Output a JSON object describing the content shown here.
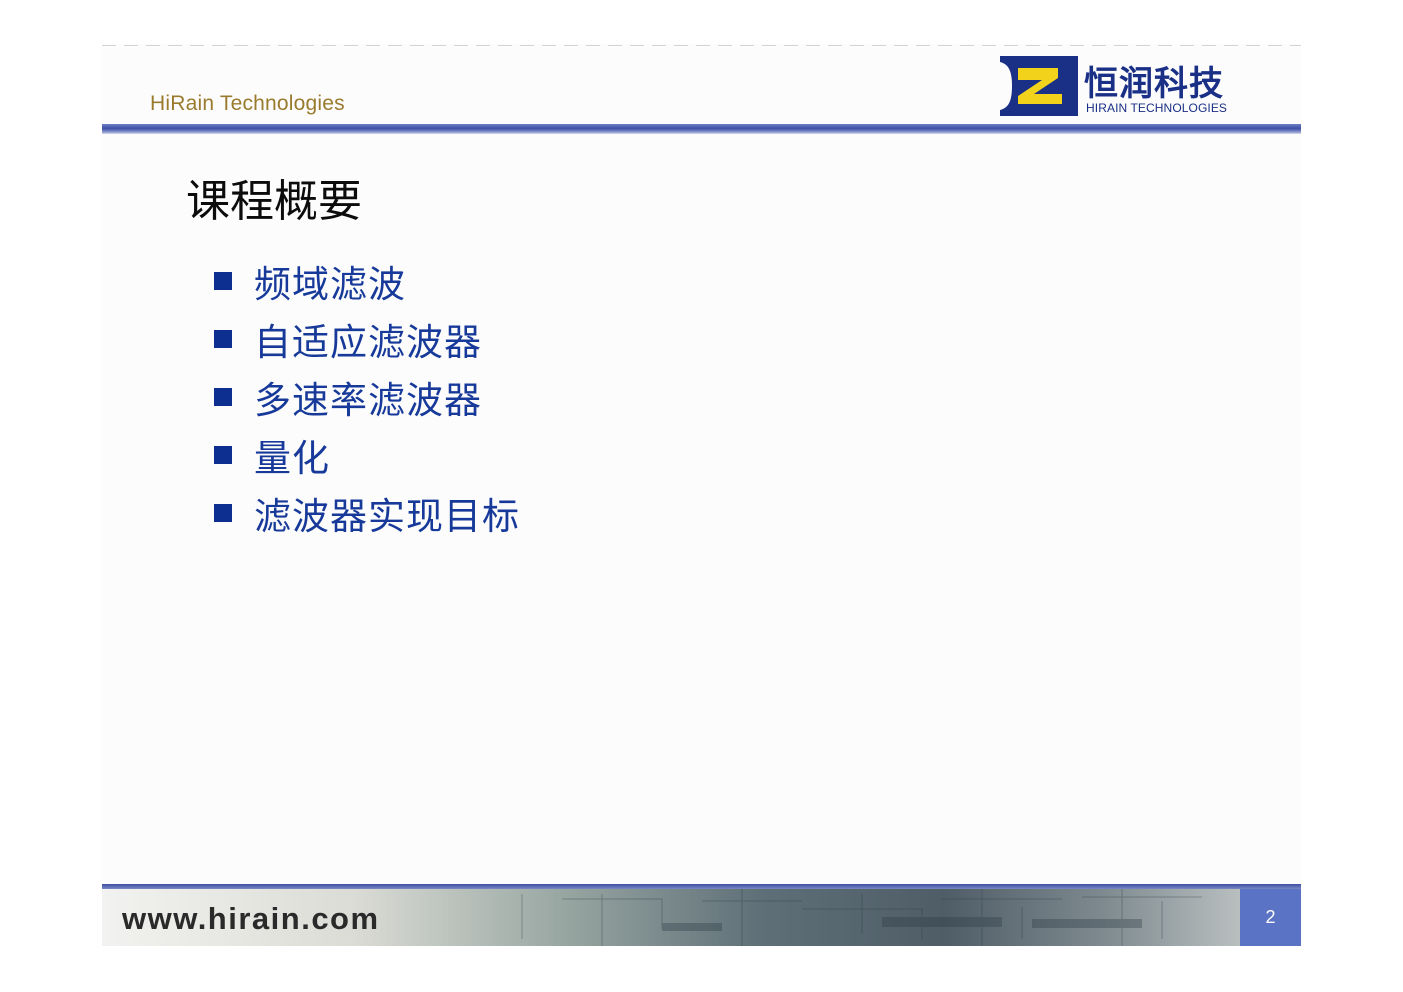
{
  "header": {
    "brand": "HiRain Technologies",
    "logo_cn": "恒润科技",
    "logo_en": "HIRAIN TECHNOLOGIES",
    "logo_icon": "hirain-logo-icon"
  },
  "title": "课程概要",
  "bullets": [
    {
      "text": "频域滤波"
    },
    {
      "text": "自适应滤波器"
    },
    {
      "text": "多速率滤波器"
    },
    {
      "text": "量化"
    },
    {
      "text": "滤波器实现目标"
    }
  ],
  "footer": {
    "url": "www.hirain.com",
    "page": "2"
  },
  "colors": {
    "brand_blue": "#1a2f86",
    "bullet_blue": "#173a9a",
    "brand_gold": "#9a7b2e",
    "logo_yellow": "#f2d21b",
    "page_box": "#5b73c4"
  }
}
